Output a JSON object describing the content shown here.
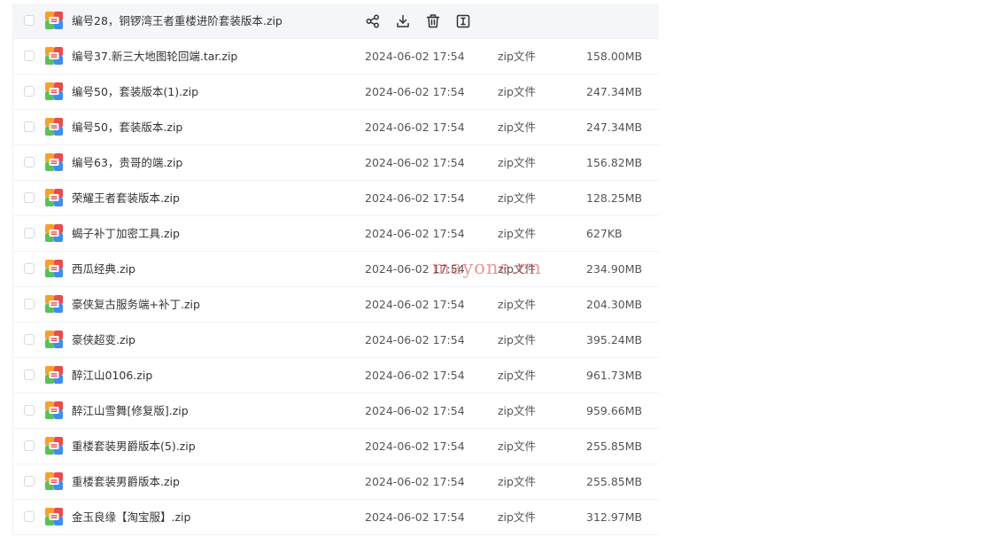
{
  "colors": {
    "hover_row_bg": "#f5f6fa",
    "icon_orange": "#f7a12a",
    "icon_red": "#ea4c4c",
    "icon_green": "#5bbf5b",
    "icon_blue": "#3e8ef0",
    "watermark_red": "#d64646"
  },
  "hover_actions": [
    {
      "name": "share-icon"
    },
    {
      "name": "download-icon"
    },
    {
      "name": "delete-icon"
    },
    {
      "name": "rename-icon"
    }
  ],
  "files": [
    {
      "name": "编号28，铜锣湾王者重楼进阶套装版本.zip",
      "mtime": "",
      "type": "",
      "size": ""
    },
    {
      "name": "编号37.新三大地图轮回端.tar.zip",
      "mtime": "2024-06-02 17:54",
      "type": "zip文件",
      "size": "158.00MB"
    },
    {
      "name": "编号50，套装版本(1).zip",
      "mtime": "2024-06-02 17:54",
      "type": "zip文件",
      "size": "247.34MB"
    },
    {
      "name": "编号50，套装版本.zip",
      "mtime": "2024-06-02 17:54",
      "type": "zip文件",
      "size": "247.34MB"
    },
    {
      "name": "编号63，贵哥的端.zip",
      "mtime": "2024-06-02 17:54",
      "type": "zip文件",
      "size": "156.82MB"
    },
    {
      "name": "荣耀王者套装版本.zip",
      "mtime": "2024-06-02 17:54",
      "type": "zip文件",
      "size": "128.25MB"
    },
    {
      "name": "蝎子补丁加密工具.zip",
      "mtime": "2024-06-02 17:54",
      "type": "zip文件",
      "size": "627KB"
    },
    {
      "name": "西瓜经典.zip",
      "mtime": "2024-06-02 17:54",
      "type": "zip文件",
      "size": "234.90MB"
    },
    {
      "name": "豪侠复古服务端+补丁.zip",
      "mtime": "2024-06-02 17:54",
      "type": "zip文件",
      "size": "204.30MB"
    },
    {
      "name": "豪侠超变.zip",
      "mtime": "2024-06-02 17:54",
      "type": "zip文件",
      "size": "395.24MB"
    },
    {
      "name": "醉江山0106.zip",
      "mtime": "2024-06-02 17:54",
      "type": "zip文件",
      "size": "961.73MB"
    },
    {
      "name": "醉江山雪舞[修复版].zip",
      "mtime": "2024-06-02 17:54",
      "type": "zip文件",
      "size": "959.66MB"
    },
    {
      "name": "重楼套装男爵版本(5).zip",
      "mtime": "2024-06-02 17:54",
      "type": "zip文件",
      "size": "255.85MB"
    },
    {
      "name": "重楼套装男爵版本.zip",
      "mtime": "2024-06-02 17:54",
      "type": "zip文件",
      "size": "255.85MB"
    },
    {
      "name": "金玉良缘【淘宝服】.zip",
      "mtime": "2024-06-02 17:54",
      "type": "zip文件",
      "size": "312.97MB"
    }
  ],
  "watermark": "mayone.cn"
}
